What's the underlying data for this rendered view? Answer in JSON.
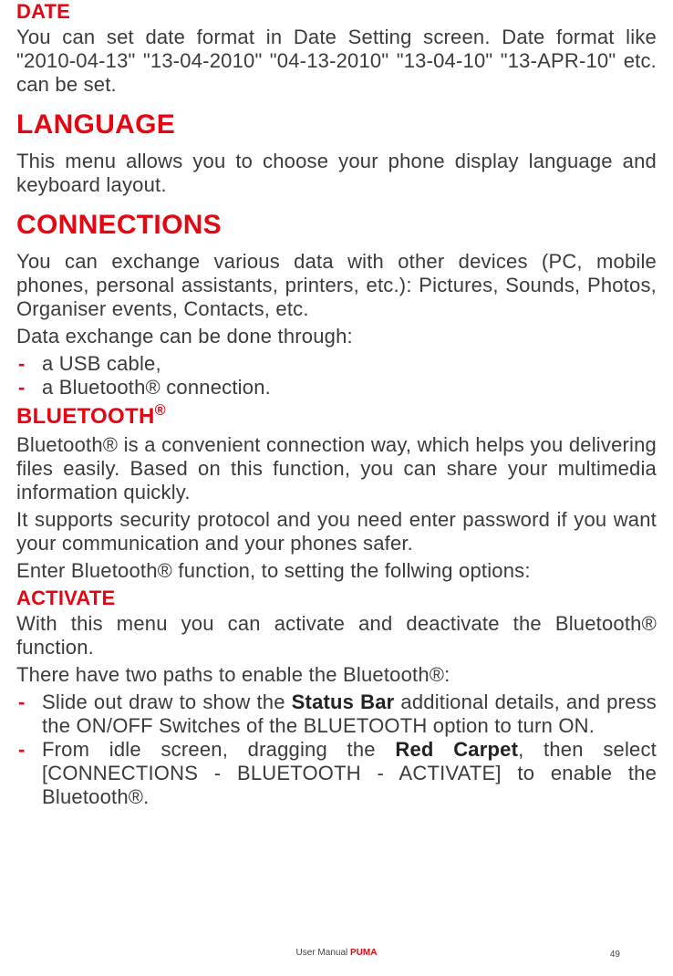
{
  "date": {
    "heading": "DATE",
    "body": "You can set date format in Date Setting screen. Date format like \"2010-04-13\" \"13-04-2010\" \"04-13-2010\" \"13-04-10\" \"13-APR-10\" etc. can be set."
  },
  "language": {
    "heading": "LANGUAGE",
    "body": "This menu allows you to choose your phone display language and keyboard layout."
  },
  "connections": {
    "heading": "CONNECTIONS",
    "body1": "You can exchange various data with other devices (PC, mobile phones, personal assistants, printers, etc.): Pictures, Sounds, Photos, Organiser events, Contacts, etc.",
    "body2": "Data exchange can be done through:",
    "items": [
      "a USB cable,",
      "a Bluetooth® connection."
    ]
  },
  "bluetooth": {
    "heading_pre": "BLUETOOTH",
    "heading_sup": "®",
    "body1": "Bluetooth® is a convenient connection way, which helps you delivering files easily. Based on this function, you can share your multimedia information quickly.",
    "body2": "It supports security protocol and you need enter password if you want your communication and your phones safer.",
    "body3": "Enter Bluetooth® function, to setting the follwing options:"
  },
  "activate": {
    "heading": "ACTIVATE",
    "body1": "With this menu you can activate and deactivate the Bluetooth® function.",
    "body2": "There have two paths to enable the Bluetooth®:",
    "items": [
      {
        "pre": "Slide out draw to show the ",
        "bold": "Status Bar",
        "post": " additional details, and press the ON/OFF Switches of the BLUETOOTH option to turn ON."
      },
      {
        "pre": "From idle screen, dragging the ",
        "bold": "Red Carpet",
        "post": ", then select [CONNECTIONS - BLUETOOTH - ACTIVATE] to enable the Bluetooth®."
      }
    ]
  },
  "footer": {
    "label": "User Manual ",
    "brand": "PUMA",
    "page": "49"
  }
}
